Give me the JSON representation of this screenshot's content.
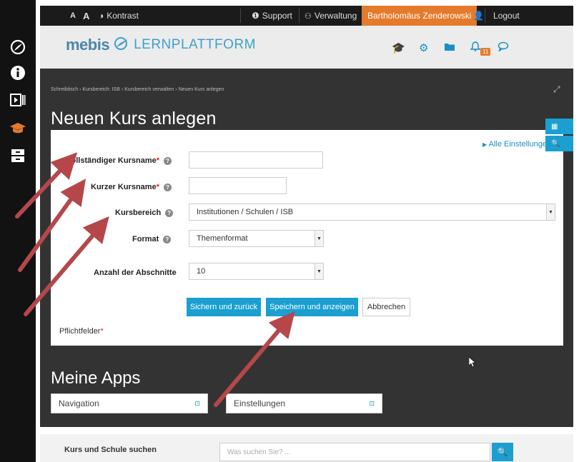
{
  "topbar": {
    "font_small": "A",
    "font_large": "A",
    "contrast": "Kontrast",
    "support": "Support",
    "admin": "Verwaltung",
    "user": "Bartholomäus Zenderowski",
    "logout": "Logout"
  },
  "header": {
    "logo_brand": "mebis",
    "logo_sub": "LERNPLATTFORM",
    "notification_count": "11"
  },
  "breadcrumb": "Schreibtisch › Kursbereich: ISB › Kursbereich verwalten › Neuen Kurs anlegen",
  "page_title": "Neuen Kurs anlegen",
  "form": {
    "all_settings": "Alle Einstellungen",
    "fullname_label": "Vollständiger Kursname",
    "shortname_label": "Kurzer Kursname",
    "category_label": "Kursbereich",
    "category_value": "Institutionen / Schulen / ISB",
    "format_label": "Format",
    "format_value": "Themenformat",
    "sections_label": "Anzahl der Abschnitte",
    "sections_value": "10",
    "btn_save_return": "Sichern und zurück",
    "btn_save_show": "Speichern und anzeigen",
    "btn_cancel": "Abbrechen",
    "required_note": "Pflichtfelder",
    "required_marker": "*"
  },
  "apps": {
    "title": "Meine Apps",
    "navigation": "Navigation",
    "settings": "Einstellungen"
  },
  "search": {
    "label": "Kurs und Schule suchen",
    "placeholder": "Was suchen Sie? ..."
  },
  "colors": {
    "accent": "#1a9fd0",
    "user_highlight": "#e47a2c",
    "annotation_arrow": "#b5474b"
  }
}
